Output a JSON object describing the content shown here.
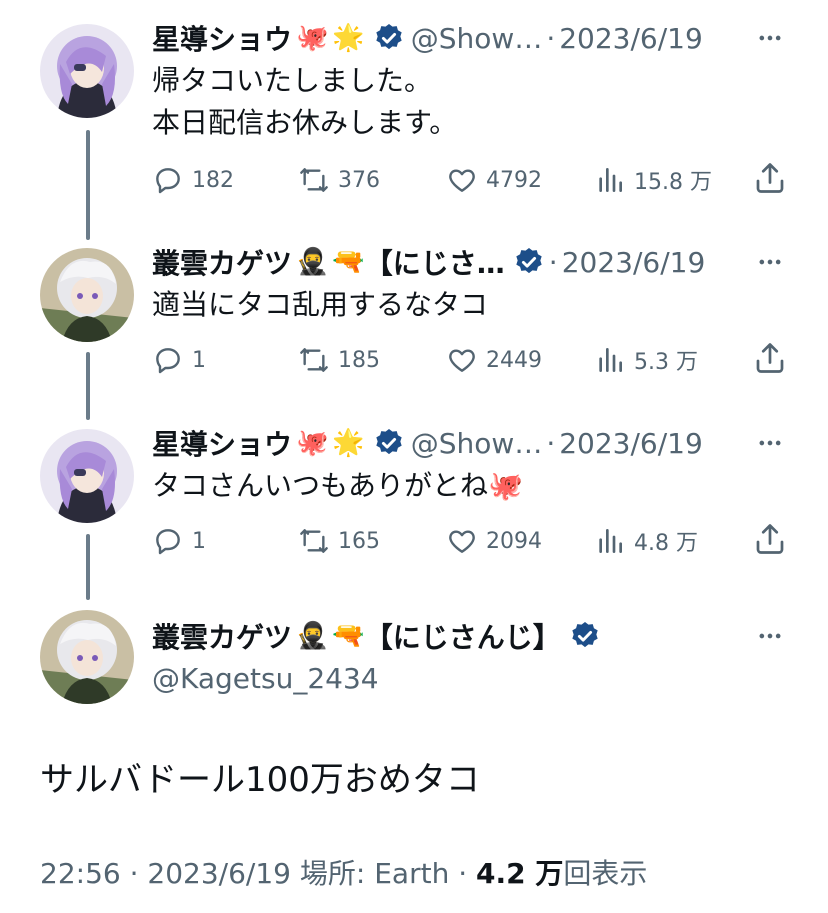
{
  "colors": {
    "verified": "#1d4e89",
    "text": "#0f1419",
    "muted": "#536471",
    "thread": "#6b7c8a"
  },
  "tweets": [
    {
      "name": "星導ショウ",
      "emojis": [
        "🐙",
        "🌟"
      ],
      "handle": "@Show…",
      "sep": "·",
      "date": "2023/6/19",
      "lines": [
        "帰タコいたしました。",
        "本日配信お休みします。"
      ],
      "replies": "182",
      "retweets": "376",
      "likes": "4792",
      "views": "15.8 万"
    },
    {
      "name": "叢雲カゲツ",
      "emojis": [
        "🥷",
        "🔫"
      ],
      "handle": "【にじさ…",
      "sep": "·",
      "date": "2023/6/19",
      "lines": [
        "適当にタコ乱用するなタコ"
      ],
      "replies": "1",
      "retweets": "185",
      "likes": "2449",
      "views": "5.3 万"
    },
    {
      "name": "星導ショウ",
      "emojis": [
        "🐙",
        "🌟"
      ],
      "handle": "@Show…",
      "sep": "·",
      "date": "2023/6/19",
      "lines": [
        "タコさんいつもありがとね🐙"
      ],
      "replies": "1",
      "retweets": "165",
      "likes": "2094",
      "views": "4.8 万"
    }
  ],
  "focus": {
    "name": "叢雲カゲツ",
    "emojis": [
      "🥷",
      "🔫"
    ],
    "tag": "【にじさんじ】",
    "handle": "@Kagetsu_2434",
    "text": "サルバドール100万おめタコ",
    "time": "22:56",
    "date": "2023/6/19",
    "location_label": "場所: Earth",
    "views_count": "4.2 万",
    "views_label": "回表示",
    "sep": "·"
  }
}
